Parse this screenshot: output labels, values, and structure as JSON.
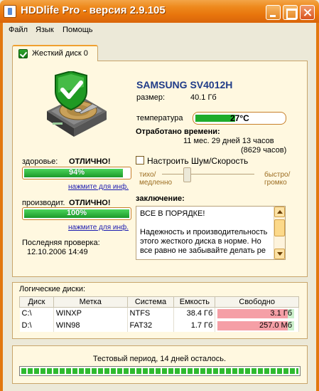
{
  "window": {
    "title": "HDDlife Pro - версия 2.9.105"
  },
  "menu": [
    "Файл",
    "Язык",
    "Помощь"
  ],
  "tab": {
    "label": "Жесткий диск 0"
  },
  "drive": {
    "name": "SAMSUNG SV4012H",
    "size_label": "размер:",
    "size_value": "40.1 Гб",
    "temperature_label": "температура",
    "temperature_value": "27°C",
    "temperature_level": 0.45,
    "uptime_label": "Отработано времени:",
    "uptime_value": "11 мес. 29 дней 13 часов",
    "uptime_hours": "(8629 часов)"
  },
  "health": {
    "label": "здоровье:",
    "status": "ОТЛИЧНО!",
    "percent_text": "94%",
    "percent": 94,
    "link": "нажмите для инф."
  },
  "performance": {
    "label": "производит.",
    "status": "ОТЛИЧНО!",
    "percent_text": "100%",
    "percent": 100,
    "link": "нажмите для инф."
  },
  "last_check": {
    "label": "Последняя проверка:",
    "value": "12.10.2006 14:49"
  },
  "noise": {
    "checkbox_label": "Настроить Шум/Скорость",
    "left_label_1": "тихо/",
    "left_label_2": "медленно",
    "right_label_1": "быстро/",
    "right_label_2": "громко",
    "level": 0.25
  },
  "conclusion": {
    "label": "заключение:",
    "line1": "ВСЕ В ПОРЯДКЕ!",
    "line2": "Надежность и производительность этого жесткого диска в норме. Но все равно не забывайте делать ре"
  },
  "logical_disks": {
    "title": "Логические диски:",
    "headers": [
      "Диск",
      "Метка",
      "Система",
      "Емкость",
      "Свободно"
    ],
    "rows": [
      {
        "disk": "C:\\",
        "label": "WINXP",
        "fs": "NTFS",
        "capacity": "38.4 Гб",
        "free": "3.1 Гб"
      },
      {
        "disk": "D:\\",
        "label": "WIN98",
        "fs": "FAT32",
        "capacity": "1.7 Гб",
        "free": "257.0 Мб"
      }
    ]
  },
  "trial": {
    "text": "Тестовый период, 14 дней осталось.",
    "progress": 1.0
  },
  "colors": {
    "accent": "#e8750c",
    "bar_green": "#1eac2c",
    "title_blue": "#1f3c88"
  }
}
